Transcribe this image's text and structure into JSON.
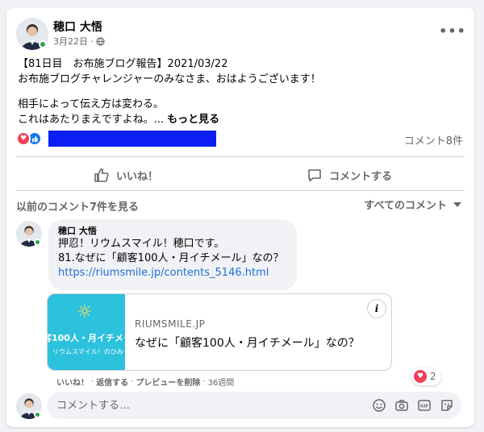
{
  "post": {
    "author": "穂口 大悟",
    "date": "3月22日",
    "separator": "·",
    "privacy_icon": "globe-icon",
    "more_icon": "•••",
    "lines": [
      "【81日目　お布施ブログ報告】2021/03/22",
      "お布施ブログチャレンジャーのみなさま、おはようございます！",
      "相手によって伝え方は変わる。",
      "これはあたりまえですよね。..."
    ],
    "see_more": "もっと見る"
  },
  "reactions": {
    "icons": [
      "love-icon",
      "like-icon"
    ],
    "redaction_color": "#0b1ff2",
    "comment_count": "コメント8件"
  },
  "actions": {
    "like": "いいね！",
    "comment": "コメントする"
  },
  "comments_header": {
    "previous": "以前のコメント7件を見る",
    "sort": "すべてのコメント"
  },
  "comment": {
    "author": "穂口 大悟",
    "lines": [
      "押忍！リウムスマイル！穂口です。",
      "81.なぜに「顧客100人・月イチメール」なの？"
    ],
    "link": "https://riumsmile.jp/contents_5146.html",
    "preview": {
      "thumb_title": "客100人・月イチメー",
      "thumb_subtitle": "リウムスマイル！のひみつ",
      "domain": "RIUMSMILE.JP",
      "title": "なぜに「顧客100人・月イチメール」なの？"
    },
    "actions": {
      "like": "いいね！",
      "reply": "返信する",
      "remove_preview": "プレビューを削除",
      "sep": "·",
      "age": "36週間"
    },
    "reaction_count": "2"
  },
  "composer": {
    "placeholder": "コメントする…"
  },
  "colors": {
    "link": "#216fdb",
    "love": "#f33e58",
    "like": "#1877f2",
    "online": "#31a24c",
    "thumb_bg": "#2cc1dc"
  }
}
